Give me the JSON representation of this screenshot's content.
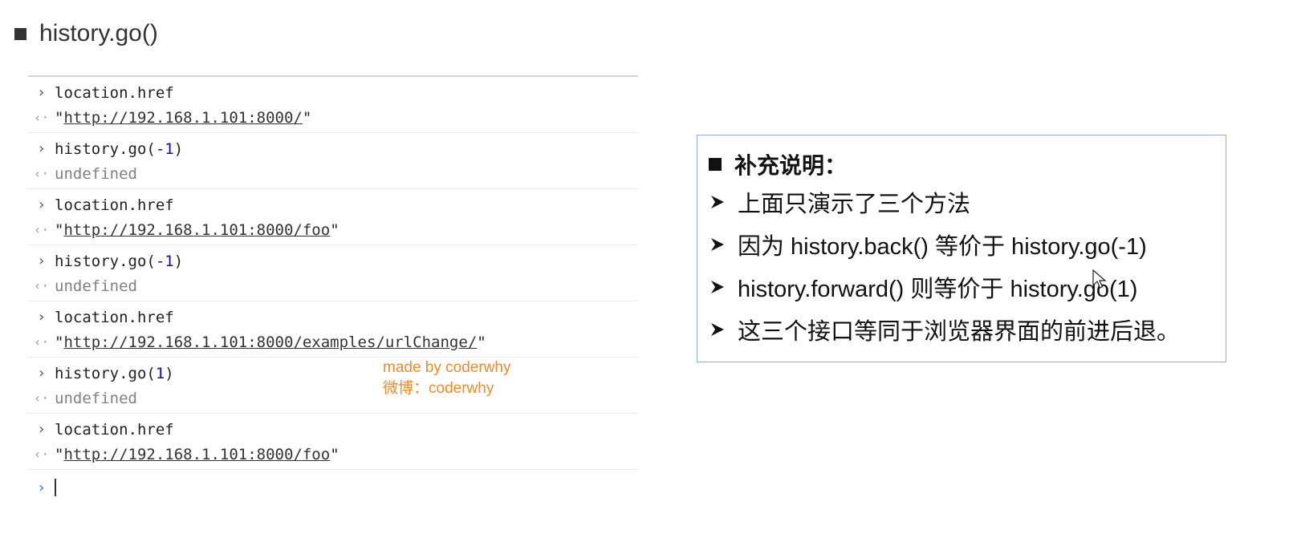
{
  "slide": {
    "title": "history.go()"
  },
  "console": {
    "entries": [
      {
        "input": "location.href",
        "result_prefix": "\"",
        "result_link": "http://192.168.1.101:8000/",
        "result_suffix": "\""
      },
      {
        "input_prefix": "history.go(",
        "input_num": "-1",
        "input_suffix": ")",
        "result": "undefined"
      },
      {
        "input": "location.href",
        "result_prefix": "\"",
        "result_link": "http://192.168.1.101:8000/foo",
        "result_suffix": "\""
      },
      {
        "input_prefix": "history.go(",
        "input_num": "-1",
        "input_suffix": ")",
        "result": "undefined"
      },
      {
        "input": "location.href",
        "result_prefix": "\"",
        "result_link": "http://192.168.1.101:8000/examples/urlChange/",
        "result_suffix": "\""
      },
      {
        "input_prefix": "history.go(",
        "input_num": "1",
        "input_suffix": ")",
        "result": "undefined"
      },
      {
        "input": "location.href",
        "result_prefix": "\"",
        "result_link": "http://192.168.1.101:8000/foo",
        "result_suffix": "\""
      }
    ],
    "prompt_icon": "chevron-right-icon",
    "result_icon": "return-arrow-icon"
  },
  "watermark": {
    "line1": "made by coderwhy",
    "line2": "微博：coderwhy"
  },
  "notes": {
    "heading": "补充说明：",
    "items": [
      "上面只演示了三个方法",
      "因为 history.back() 等价于 history.go(-1)",
      "history.forward() 则等价于 history.go(1)",
      "这三个接口等同于浏览器界面的前进后退。"
    ]
  },
  "colors": {
    "accent_number": "#1c00cf",
    "watermark": "#f08a2a",
    "box_border": "#8fb0d6",
    "active_prompt": "#2b73d9"
  }
}
